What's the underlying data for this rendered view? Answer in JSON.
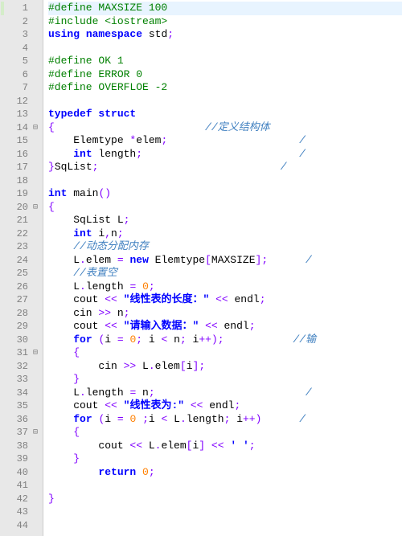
{
  "lines": [
    {
      "n": 1,
      "fold": "",
      "change": "mod",
      "hl": true,
      "tokens": [
        [
          "pp",
          "#define MAXSIZE 100"
        ]
      ]
    },
    {
      "n": 2,
      "fold": "",
      "change": "",
      "tokens": [
        [
          "pp",
          "#include "
        ],
        [
          "pp",
          "<iostream>"
        ]
      ]
    },
    {
      "n": 3,
      "fold": "",
      "change": "",
      "tokens": [
        [
          "kw",
          "using"
        ],
        [
          "id",
          " "
        ],
        [
          "kw",
          "namespace"
        ],
        [
          "id",
          " std"
        ],
        [
          "sc",
          ";"
        ]
      ]
    },
    {
      "n": 4,
      "fold": "",
      "change": "",
      "tokens": []
    },
    {
      "n": 5,
      "fold": "",
      "change": "",
      "tokens": [
        [
          "pp",
          "#define OK 1"
        ]
      ]
    },
    {
      "n": 6,
      "fold": "",
      "change": "",
      "tokens": [
        [
          "pp",
          "#define ERROR 0"
        ]
      ]
    },
    {
      "n": 7,
      "fold": "",
      "change": "",
      "tokens": [
        [
          "pp",
          "#define OVERFLOE -2"
        ]
      ]
    },
    {
      "n": 12,
      "fold": "",
      "change": "",
      "tokens": []
    },
    {
      "n": 13,
      "fold": "",
      "change": "",
      "tokens": [
        [
          "kw",
          "typedef"
        ],
        [
          "id",
          " "
        ],
        [
          "kw",
          "struct"
        ]
      ]
    },
    {
      "n": 14,
      "fold": "⊟",
      "change": "",
      "tokens": [
        [
          "br",
          "{"
        ],
        [
          "id",
          "                        "
        ],
        [
          "cm",
          "//定义结构体"
        ]
      ]
    },
    {
      "n": 15,
      "fold": "",
      "change": "",
      "tokens": [
        [
          "id",
          "    Elemtype "
        ],
        [
          "op",
          "*"
        ],
        [
          "id",
          "elem"
        ],
        [
          "sc",
          ";"
        ],
        [
          "id",
          "                     "
        ],
        [
          "cm",
          "/"
        ]
      ]
    },
    {
      "n": 16,
      "fold": "",
      "change": "",
      "tokens": [
        [
          "id",
          "    "
        ],
        [
          "kw",
          "int"
        ],
        [
          "id",
          " length"
        ],
        [
          "sc",
          ";"
        ],
        [
          "id",
          "                         "
        ],
        [
          "cm",
          "/"
        ]
      ]
    },
    {
      "n": 17,
      "fold": "",
      "change": "",
      "tokens": [
        [
          "br",
          "}"
        ],
        [
          "id",
          "SqList"
        ],
        [
          "sc",
          ";"
        ],
        [
          "id",
          "                             "
        ],
        [
          "cm",
          "/"
        ]
      ]
    },
    {
      "n": 18,
      "fold": "",
      "change": "",
      "tokens": []
    },
    {
      "n": 19,
      "fold": "",
      "change": "",
      "tokens": [
        [
          "kw",
          "int"
        ],
        [
          "id",
          " "
        ],
        [
          "fn",
          "main"
        ],
        [
          "br",
          "()"
        ]
      ]
    },
    {
      "n": 20,
      "fold": "⊟",
      "change": "",
      "tokens": [
        [
          "br",
          "{"
        ]
      ]
    },
    {
      "n": 21,
      "fold": "",
      "change": "",
      "tokens": [
        [
          "id",
          "    SqList L"
        ],
        [
          "sc",
          ";"
        ]
      ]
    },
    {
      "n": 22,
      "fold": "",
      "change": "",
      "tokens": [
        [
          "id",
          "    "
        ],
        [
          "kw",
          "int"
        ],
        [
          "id",
          " i"
        ],
        [
          "op",
          ","
        ],
        [
          "id",
          "n"
        ],
        [
          "sc",
          ";"
        ]
      ]
    },
    {
      "n": 23,
      "fold": "",
      "change": "",
      "tokens": [
        [
          "id",
          "    "
        ],
        [
          "cm",
          "//动态分配内存"
        ]
      ]
    },
    {
      "n": 24,
      "fold": "",
      "change": "",
      "tokens": [
        [
          "id",
          "    L"
        ],
        [
          "op",
          "."
        ],
        [
          "id",
          "elem "
        ],
        [
          "op",
          "="
        ],
        [
          "id",
          " "
        ],
        [
          "kw",
          "new"
        ],
        [
          "id",
          " Elemtype"
        ],
        [
          "br",
          "["
        ],
        [
          "id",
          "MAXSIZE"
        ],
        [
          "br",
          "]"
        ],
        [
          "sc",
          ";"
        ],
        [
          "id",
          "      "
        ],
        [
          "cm",
          "/"
        ]
      ]
    },
    {
      "n": 25,
      "fold": "",
      "change": "",
      "tokens": [
        [
          "id",
          "    "
        ],
        [
          "cm",
          "//表置空"
        ]
      ]
    },
    {
      "n": 26,
      "fold": "",
      "change": "",
      "tokens": [
        [
          "id",
          "    L"
        ],
        [
          "op",
          "."
        ],
        [
          "id",
          "length "
        ],
        [
          "op",
          "="
        ],
        [
          "id",
          " "
        ],
        [
          "num",
          "0"
        ],
        [
          "sc",
          ";"
        ]
      ]
    },
    {
      "n": 27,
      "fold": "",
      "change": "",
      "tokens": [
        [
          "id",
          "    cout "
        ],
        [
          "op",
          "<<"
        ],
        [
          "id",
          " "
        ],
        [
          "str",
          "\"线性表的长度：\""
        ],
        [
          "id",
          " "
        ],
        [
          "op",
          "<<"
        ],
        [
          "id",
          " endl"
        ],
        [
          "sc",
          ";"
        ]
      ]
    },
    {
      "n": 28,
      "fold": "",
      "change": "",
      "tokens": [
        [
          "id",
          "    cin "
        ],
        [
          "op",
          ">>"
        ],
        [
          "id",
          " n"
        ],
        [
          "sc",
          ";"
        ]
      ]
    },
    {
      "n": 29,
      "fold": "",
      "change": "",
      "tokens": [
        [
          "id",
          "    cout "
        ],
        [
          "op",
          "<<"
        ],
        [
          "id",
          " "
        ],
        [
          "str",
          "\"请输入数据：\""
        ],
        [
          "id",
          " "
        ],
        [
          "op",
          "<<"
        ],
        [
          "id",
          " endl"
        ],
        [
          "sc",
          ";"
        ]
      ]
    },
    {
      "n": 30,
      "fold": "",
      "change": "",
      "tokens": [
        [
          "id",
          "    "
        ],
        [
          "kw",
          "for"
        ],
        [
          "id",
          " "
        ],
        [
          "br",
          "("
        ],
        [
          "id",
          "i "
        ],
        [
          "op",
          "="
        ],
        [
          "id",
          " "
        ],
        [
          "num",
          "0"
        ],
        [
          "sc",
          ";"
        ],
        [
          "id",
          " i "
        ],
        [
          "op",
          "<"
        ],
        [
          "id",
          " n"
        ],
        [
          "sc",
          ";"
        ],
        [
          "id",
          " i"
        ],
        [
          "op",
          "++"
        ],
        [
          "br",
          ")"
        ],
        [
          "sc",
          ";"
        ],
        [
          "id",
          "           "
        ],
        [
          "cm",
          "//输"
        ]
      ]
    },
    {
      "n": 31,
      "fold": "⊟",
      "change": "",
      "tokens": [
        [
          "id",
          "    "
        ],
        [
          "br",
          "{"
        ]
      ]
    },
    {
      "n": 32,
      "fold": "",
      "change": "",
      "tokens": [
        [
          "id",
          "        cin "
        ],
        [
          "op",
          ">>"
        ],
        [
          "id",
          " L"
        ],
        [
          "op",
          "."
        ],
        [
          "id",
          "elem"
        ],
        [
          "br",
          "["
        ],
        [
          "id",
          "i"
        ],
        [
          "br",
          "]"
        ],
        [
          "sc",
          ";"
        ]
      ]
    },
    {
      "n": 33,
      "fold": "",
      "change": "",
      "tokens": [
        [
          "id",
          "    "
        ],
        [
          "br",
          "}"
        ]
      ]
    },
    {
      "n": 34,
      "fold": "",
      "change": "",
      "tokens": [
        [
          "id",
          "    L"
        ],
        [
          "op",
          "."
        ],
        [
          "id",
          "length "
        ],
        [
          "op",
          "="
        ],
        [
          "id",
          " n"
        ],
        [
          "sc",
          ";"
        ],
        [
          "id",
          "                        "
        ],
        [
          "cm",
          "/"
        ]
      ]
    },
    {
      "n": 35,
      "fold": "",
      "change": "",
      "tokens": [
        [
          "id",
          "    cout "
        ],
        [
          "op",
          "<<"
        ],
        [
          "id",
          " "
        ],
        [
          "str",
          "\"线性表为:\""
        ],
        [
          "id",
          " "
        ],
        [
          "op",
          "<<"
        ],
        [
          "id",
          " endl"
        ],
        [
          "sc",
          ";"
        ]
      ]
    },
    {
      "n": 36,
      "fold": "",
      "change": "",
      "tokens": [
        [
          "id",
          "    "
        ],
        [
          "kw",
          "for"
        ],
        [
          "id",
          " "
        ],
        [
          "br",
          "("
        ],
        [
          "id",
          "i "
        ],
        [
          "op",
          "="
        ],
        [
          "id",
          " "
        ],
        [
          "num",
          "0"
        ],
        [
          "id",
          " "
        ],
        [
          "sc",
          ";"
        ],
        [
          "id",
          "i "
        ],
        [
          "op",
          "<"
        ],
        [
          "id",
          " L"
        ],
        [
          "op",
          "."
        ],
        [
          "id",
          "length"
        ],
        [
          "sc",
          ";"
        ],
        [
          "id",
          " i"
        ],
        [
          "op",
          "++"
        ],
        [
          "br",
          ")"
        ],
        [
          "id",
          "      "
        ],
        [
          "cm",
          "/"
        ]
      ]
    },
    {
      "n": 37,
      "fold": "⊟",
      "change": "",
      "tokens": [
        [
          "id",
          "    "
        ],
        [
          "br",
          "{"
        ]
      ]
    },
    {
      "n": 38,
      "fold": "",
      "change": "",
      "tokens": [
        [
          "id",
          "        cout "
        ],
        [
          "op",
          "<<"
        ],
        [
          "id",
          " L"
        ],
        [
          "op",
          "."
        ],
        [
          "id",
          "elem"
        ],
        [
          "br",
          "["
        ],
        [
          "id",
          "i"
        ],
        [
          "br",
          "]"
        ],
        [
          "id",
          " "
        ],
        [
          "op",
          "<<"
        ],
        [
          "id",
          " "
        ],
        [
          "str",
          "' '"
        ],
        [
          "sc",
          ";"
        ]
      ]
    },
    {
      "n": 39,
      "fold": "",
      "change": "",
      "tokens": [
        [
          "id",
          "    "
        ],
        [
          "br",
          "}"
        ]
      ]
    },
    {
      "n": 40,
      "fold": "",
      "change": "",
      "tokens": [
        [
          "id",
          "        "
        ],
        [
          "kw",
          "return"
        ],
        [
          "id",
          " "
        ],
        [
          "num",
          "0"
        ],
        [
          "sc",
          ";"
        ]
      ]
    },
    {
      "n": 41,
      "fold": "",
      "change": "",
      "tokens": []
    },
    {
      "n": 42,
      "fold": "",
      "change": "",
      "tokens": [
        [
          "br",
          "}"
        ]
      ]
    },
    {
      "n": 43,
      "fold": "",
      "change": "",
      "tokens": []
    },
    {
      "n": 44,
      "fold": "",
      "change": "",
      "tokens": []
    }
  ],
  "fold_glyph": "⊟"
}
